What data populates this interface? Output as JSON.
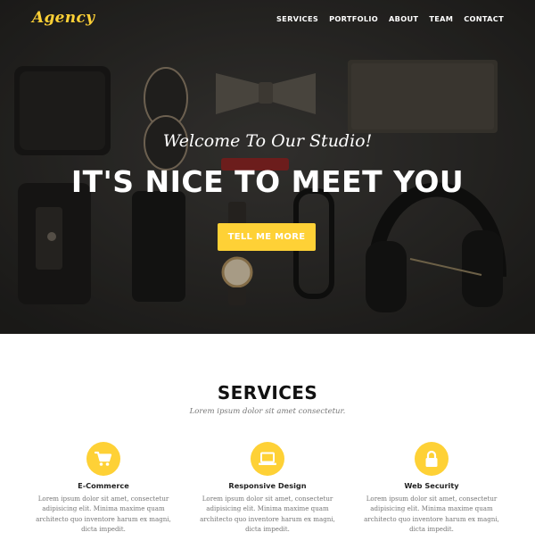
{
  "brand": {
    "name": "Agency"
  },
  "nav": {
    "items": [
      "SERVICES",
      "PORTFOLIO",
      "ABOUT",
      "TEAM",
      "CONTACT"
    ]
  },
  "hero": {
    "subtitle": "Welcome To Our Studio!",
    "title": "IT'S NICE TO MEET YOU",
    "button_label": "TELL ME MORE"
  },
  "services": {
    "heading": "SERVICES",
    "subheading": "Lorem ipsum dolor sit amet consectetur.",
    "items": [
      {
        "icon": "shopping-cart-icon",
        "title": "E-Commerce",
        "text": "Lorem ipsum dolor sit amet, consectetur adipisicing elit. Minima maxime quam architecto quo inventore harum ex magni, dicta impedit."
      },
      {
        "icon": "laptop-icon",
        "title": "Responsive Design",
        "text": "Lorem ipsum dolor sit amet, consectetur adipisicing elit. Minima maxime quam architecto quo inventore harum ex magni, dicta impedit."
      },
      {
        "icon": "lock-icon",
        "title": "Web Security",
        "text": "Lorem ipsum dolor sit amet, consectetur adipisicing elit. Minima maxime quam architecto quo inventore harum ex magni, dicta impedit."
      }
    ]
  },
  "colors": {
    "accent": "#fed136",
    "hero_bg": "#2b2a29",
    "text_dark": "#111111",
    "text_muted": "#777777"
  }
}
